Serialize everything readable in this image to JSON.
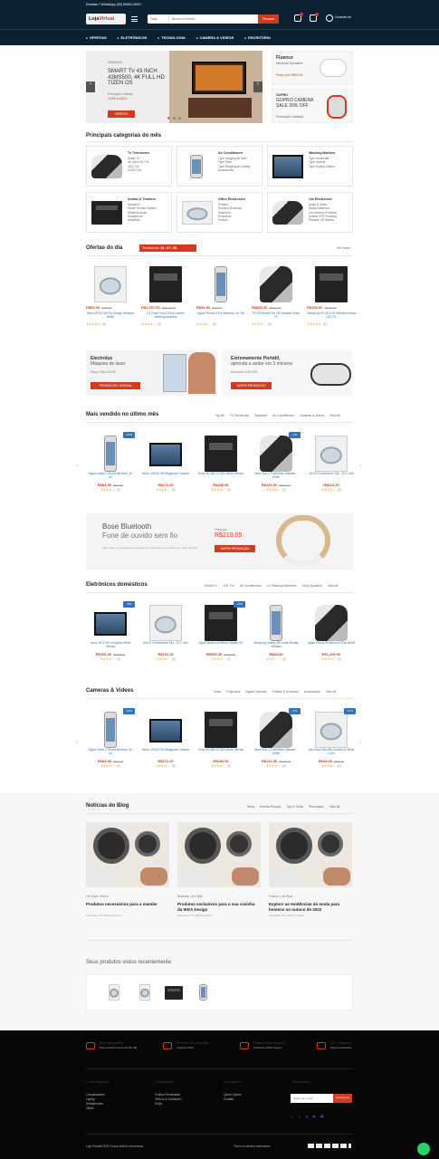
{
  "header": {
    "topbar": "Dúvidas ? WhatsApp (00) 00000-0000 !",
    "logo_a": "Loja",
    "logo_b": "Virtual",
    "search_category": "Todo",
    "search_placeholder": "Buscar somente...",
    "search_button": "Procurar",
    "account_label": "Conecte-se",
    "colors": {
      "bg": "#0c2233",
      "accent": "#d33a1f"
    }
  },
  "nav": [
    "OFERTAS",
    "ELETRÔNICOS",
    "TECNOLOGIA",
    "CAMERA & VIDEOS",
    "ESCRITÓRIO"
  ],
  "slider": {
    "kicker": "SAMSUNG",
    "title": "SMART TV 43 INCH 43MS500, 4K FULL HD TIZEN OS",
    "promo": "Promoção Limitada",
    "promo2": "21/03 à 15/10",
    "button": "OFERTA"
  },
  "side_banners": [
    {
      "title": "Fluence",
      "subtitle": "Minimal Speaker",
      "price": "Preço por R$59.99"
    },
    {
      "title": "GOPRO",
      "subtitle": "GOPRO CAMERA SALE 30% OFF",
      "price": "Promoção Limitada"
    }
  ],
  "categories": {
    "title": "Principais categorias do mês",
    "items": [
      {
        "name": "Tv Televisores",
        "links": [
          "Smart TV",
          "4K Ultra HD TVs",
          "LED TVs",
          "OLED TVs"
        ]
      },
      {
        "name": "Air Conditioners",
        "links": [
          "Type Hanging Air-Wall",
          "Type Floor",
          "Type Hanging Air-Ceiling",
          "Accessories"
        ]
      },
      {
        "name": "Washing Machine",
        "links": [
          "Type Horizontal",
          "Type Vertical",
          "Type Drying Clothes"
        ]
      },
      {
        "name": "Audios & Theaters",
        "links": [
          "Speakers",
          "Home Theater System",
          "Wireless Audio",
          "Headphone",
          "Amplifiers"
        ]
      },
      {
        "name": "Office Electronics",
        "links": [
          "Printers",
          "Stores & Business",
          "Scanners",
          "Projectors",
          "Phones"
        ]
      },
      {
        "name": "Car Electronics",
        "links": [
          "Audio & Video",
          "Radar Detectors",
          "Car Security Products",
          "Vehicle GPS Tracking",
          "Portable CB Radios"
        ]
      }
    ]
  },
  "deals": {
    "title": "Ofertas do dia",
    "timer_label": "Termina em:",
    "timer": "04 : 07 : 55",
    "view_all": "Ver Todos",
    "items": [
      {
        "price": "R$60.00",
        "old": "R$69.00",
        "name": "Aficio SP 5210e Pro Design Wireless White",
        "rating": "★★★★★",
        "count": "(0)"
      },
      {
        "price": "R$1,007.00",
        "old": "R$4,029.00",
        "name": "LG Fresh Front 20in1 Inverter Washing Machine",
        "rating": "★★★★☆",
        "count": "(0)"
      },
      {
        "price": "R$54.90",
        "old": "R$69.00",
        "name": "Apple iPhone 8 Pro Wireless, 64 GB",
        "rating": "★★★★☆",
        "count": "(0)"
      },
      {
        "price": "R$880.00",
        "old": "R$914.00",
        "name": "Tilt VR Helmet 3D VR Headset Smart TV",
        "rating": "★★★★☆",
        "count": "(0)"
      },
      {
        "price": "R$180.00",
        "old": "R$230.00",
        "name": "Samsung HP 0474 49 Wireless Smart LED TV",
        "rating": "★★★★★",
        "count": "(0)"
      }
    ]
  },
  "promo_banners": [
    {
      "title": "Electrolux",
      "subtitle": "Máquina de lavar",
      "price": "Preço: R$4.229,99",
      "button": "PROMOÇÃO LIMITADA"
    },
    {
      "title": "Extremamente Portátil,",
      "subtitle": "aprenda a andar em 3 minutos",
      "price": "Desconto: 10% OFF",
      "button": "SUPER PROMOÇÃO"
    }
  ],
  "bestsellers": {
    "title": "Mais vendido no último mês",
    "tabs": [
      "Top All",
      "TV Televisores",
      "Speakers",
      "Air Conditioners",
      "Cameras & Videos",
      "View All"
    ],
    "items": [
      {
        "tag": "-10%",
        "name": "Gigaro Nano X Smart Wireless, 4G 4G",
        "price": "R$84.95",
        "old": "R$94.95",
        "rating": "★★★★☆",
        "count": "(0)"
      },
      {
        "tag": "",
        "name": "Mixer 120x20 SN Megapixel Camera",
        "price": "R$272.20",
        "old": "",
        "rating": "★★★★☆",
        "count": "(0)"
      },
      {
        "tag": "",
        "name": "Sony HD-980 15 980 White Version",
        "price": "R$280.90",
        "old": "",
        "rating": "★★★★☆",
        "count": "(0)"
      },
      {
        "tag": "-7%",
        "name": "Beat Solo 2.0 Wireless Speaker - White",
        "price": "R$120.00",
        "old": "R$129.00",
        "rating": "★★★★☆",
        "count": "(0)"
      },
      {
        "tag": "",
        "name": "ASUS Chromebook Flip - 10.2 Inch",
        "price": "R$222.20",
        "old": "",
        "rating": "★★★★☆",
        "count": "(0)"
      }
    ]
  },
  "bose": {
    "title": "Bose Bluetooth",
    "subtitle": "Fone de ouvido sem fio",
    "price_label": "Preço por",
    "price": "R$219.05",
    "desc": "Sem ruído, a experiência em áudio sem para fone de ouvido com mais clareza.",
    "button": "SUPER PROMOÇÃO"
  },
  "domestic": {
    "title": "Eletrônicos domésticos",
    "tabs": [
      "Smart TV",
      "LED TVs",
      "Air Conditioners",
      "LG Washing Machines",
      "Sony Speakers",
      "View All"
    ],
    "items": [
      {
        "tag": "-8%",
        "name": "Xerox 4970 36 Compilme White Version",
        "price": "R$100.00",
        "old": "R$108.00",
        "rating": "★★★★☆",
        "count": "(0)"
      },
      {
        "tag": "",
        "name": "ASUS Chromebook Flip - 10.2 Inch",
        "price": "R$222.20",
        "old": "",
        "rating": "★★★★☆",
        "count": "(0)"
      },
      {
        "tag": "-34%",
        "name": "Apple Macbook Retina Display 16\"",
        "price": "R$659.00",
        "old": "R$999.00",
        "rating": "★★★★☆",
        "count": "(0)"
      },
      {
        "tag": "",
        "name": "Samsung Galaxy S8 Virtual Reality Headset",
        "price": "R$84.90",
        "old": "",
        "rating": "★★★☆☆",
        "count": "(0)"
      },
      {
        "tag": "",
        "name": "Apple iPhone 8 Retina 64 Plus 64GB",
        "price": "R$1,200.00",
        "old": "",
        "rating": "★★★★☆",
        "count": "(0)"
      }
    ]
  },
  "cameras": {
    "title": "Cameras & Videos",
    "tabs": [
      "Video",
      "Projectors",
      "Digital Cameras",
      "Printers & Scanners",
      "Accessories",
      "View All"
    ],
    "items": [
      {
        "tag": "-10%",
        "name": "Gigaro Nano X Smart Wireless, 4G 4G",
        "price": "R$84.95",
        "old": "R$94.95",
        "rating": "★★★★☆",
        "count": "(0)"
      },
      {
        "tag": "",
        "name": "Mixer 120x20 SN Megapixel Camera",
        "price": "R$272.20",
        "old": "",
        "rating": "★★★★☆",
        "count": "(0)"
      },
      {
        "tag": "",
        "name": "Sony HD-980 15 980 White Version",
        "price": "R$280.90",
        "old": "",
        "rating": "★★★★☆",
        "count": "(0)"
      },
      {
        "tag": "-7%",
        "name": "Beat Solo 2.0 Wireless Speaker - White",
        "price": "R$120.00",
        "old": "R$129.00",
        "rating": "★★★★☆",
        "count": "(0)"
      },
      {
        "tag": "-17%",
        "name": "InfoComp Security Camera & White Color",
        "price": "R$45.00",
        "old": "R$54.00",
        "rating": "★★★★☆",
        "count": "(0)"
      }
    ]
  },
  "blog": {
    "title": "Notícias do Blog",
    "tabs": [
      "News",
      "Review Product",
      "Tips & Tricks",
      "Promotions",
      "View All"
    ],
    "posts": [
      {
        "cat": "Life Style, Others",
        "title": "Produtos necessários para a mamãe",
        "date": "Novembro 15, 2020 by admin"
      },
      {
        "cat": "Business, Life Style",
        "title": "Produtos exclusivos para a sua cozinha da IKEA Design",
        "date": "Novembro 15, 2020 by admin"
      },
      {
        "cat": "Fashion, Life Style",
        "title": "Explore as tendências da moda para homens no outono de 2022",
        "date": "Novembro 15, 2020 by admin"
      }
    ]
  },
  "recent": {
    "title": "Seus produtos vistos recentemente"
  },
  "footer": {
    "features": [
      {
        "title": "Entrega grátis",
        "sub": "Para pedidos acima de R$ 160"
      },
      {
        "title": "90 Dias de Garantia",
        "sub": "Garantia Total"
      },
      {
        "title": "Pagamento Seguro",
        "sub": "Ambiente 100% Seguro"
      },
      {
        "title": "24/7 Suporte",
        "sub": "Suporte dedicado"
      }
    ],
    "cols": [
      {
        "title": "Links Rápidos",
        "links": [
          "Computadores",
          "Laptop",
          "Smartphones",
          "Tablet"
        ]
      },
      {
        "title": "Companhia",
        "links": [
          "Política Privacidade",
          "Termos & Condições",
          "FAQs"
        ]
      },
      {
        "title": "O negócio",
        "links": [
          "Quem Somos",
          "Contato"
        ]
      },
      {
        "title": "Newsletter",
        "links": []
      }
    ],
    "newsletter_placeholder": "Digite seu email",
    "newsletter_button": "Inscreva-se",
    "copyright": "Loja VirtualB 2022 Todos direitos reservados",
    "rights": "Todos os direitos reservados"
  }
}
